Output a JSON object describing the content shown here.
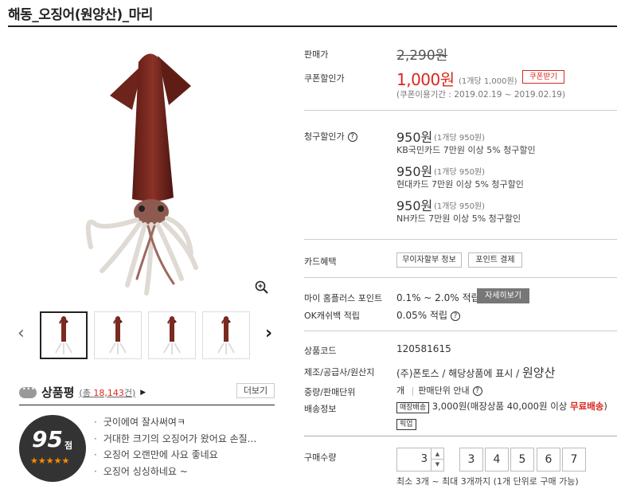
{
  "product": {
    "title": "해동_오징어(원양산)_마리",
    "price_label": "판매가",
    "price": "2,290원",
    "coupon_label": "쿠폰할인가",
    "coupon_price": "1,000원",
    "coupon_unit": "(1개당 1,000원)",
    "coupon_button": "쿠폰받기",
    "coupon_period": "(쿠폰이용기간 : 2019.02.19 ~ 2019.02.19)"
  },
  "billing": {
    "label": "청구할인가",
    "qmark": "?",
    "items": [
      {
        "price": "950원",
        "unit": "(1개당 950원)",
        "desc": "KB국민카드 7만원 이상 5% 청구할인"
      },
      {
        "price": "950원",
        "unit": "(1개당 950원)",
        "desc": "현대카드 7만원 이상 5% 청구할인"
      },
      {
        "price": "950원",
        "unit": "(1개당 950원)",
        "desc": "NH카드 7만원 이상 5% 청구할인"
      }
    ]
  },
  "card_benefit": {
    "label": "카드혜택",
    "btn1": "무이자할부 정보",
    "btn2": "포인트 결제"
  },
  "points": {
    "label1": "마이 홈플러스 포인트",
    "value1": "0.1% ~ 2.0% 적립",
    "detail_button": "자세히보기",
    "label2": "OK캐쉬백 적립",
    "value2": "0.05% 적립",
    "qmark": "?"
  },
  "info": {
    "code_label": "상품코드",
    "code": "120581615",
    "maker_label": "제조/공급사/원산지",
    "maker": "(주)폰토스 / 해당상품에 표시 /",
    "origin": "원양산",
    "unit_label": "중량/판매단위",
    "unit": "개",
    "unit_sep": "|",
    "unit_guide": "판매단위 안내",
    "qmark": "?",
    "ship_label": "배송정보",
    "ship_tag": "매장배송",
    "ship_text": "3,000원(매장상품 40,000원 이상",
    "ship_free": "무료배송",
    "ship_end": ")",
    "pickup_tag": "픽업"
  },
  "purchase": {
    "label": "구매수량",
    "qty": "3",
    "up": "▲",
    "down": "▼",
    "options": [
      "3",
      "4",
      "5",
      "6",
      "7"
    ],
    "note": "최소 3개 ~ 최대 3개까지 (1개 단위로 구매 가능)"
  },
  "review": {
    "title": "상품평",
    "count_prefix": "(총 ",
    "count": "18,143",
    "count_suffix": "건)",
    "more": "더보기",
    "score": "95",
    "score_unit": "점",
    "stars": "★★★★★",
    "items": [
      "굿이에여 잘사써여ㅋ",
      "거대한 크기의 오징어가 왔어요 손질...",
      "오징어 오랜만에 사요 좋네요",
      "오징어 싱싱하네요 ~"
    ]
  },
  "gallery": {
    "prev": "‹",
    "next": "›"
  },
  "colors": {
    "accent_red": "#d9281f",
    "star_orange": "#ff8a00"
  }
}
